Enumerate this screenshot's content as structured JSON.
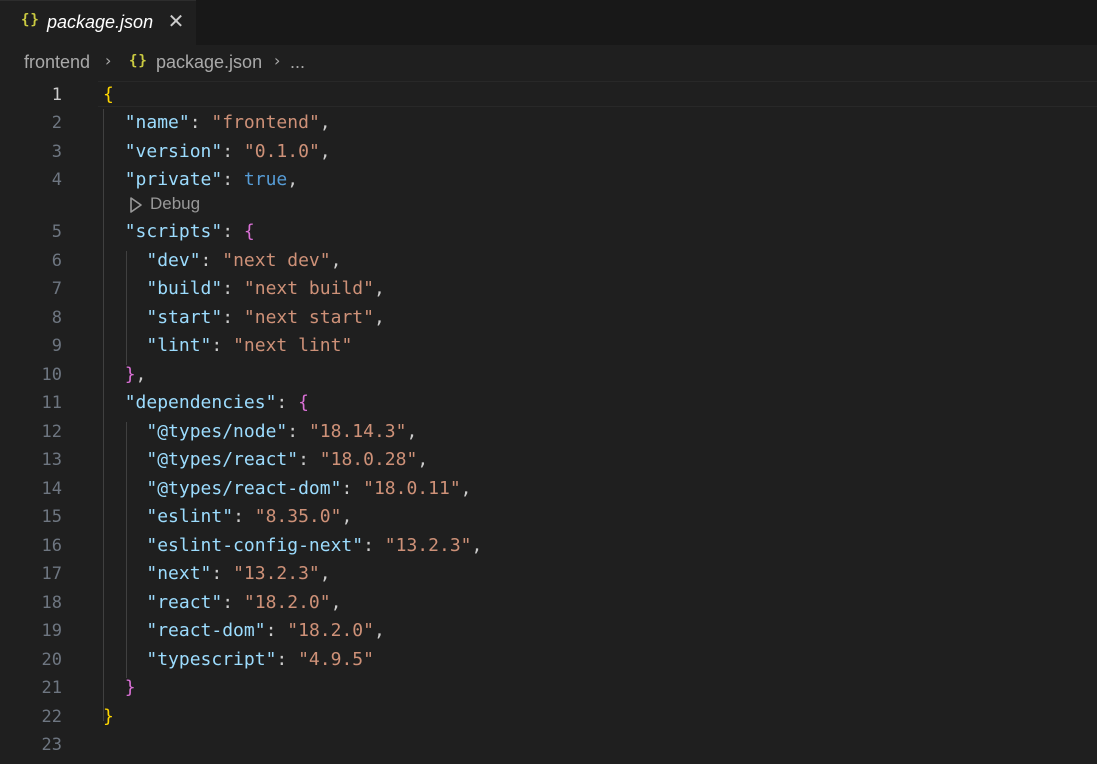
{
  "tab": {
    "icon": "{}",
    "title": "package.json",
    "close": "✕"
  },
  "breadcrumb": {
    "folder": "frontend",
    "file_icon": "{}",
    "file": "package.json",
    "more": "..."
  },
  "codelens": {
    "label": "Debug"
  },
  "colors": {
    "key": "#9cdcfe",
    "string": "#ce9178",
    "boolean": "#569cd6",
    "bracket_level1": "#ffd700",
    "bracket_level2": "#da70d6",
    "json_icon": "#cbcb41"
  },
  "lines": [
    {
      "n": "1"
    },
    {
      "n": "2"
    },
    {
      "n": "3"
    },
    {
      "n": "4"
    },
    {
      "n": "5"
    },
    {
      "n": "6"
    },
    {
      "n": "7"
    },
    {
      "n": "8"
    },
    {
      "n": "9"
    },
    {
      "n": "10"
    },
    {
      "n": "11"
    },
    {
      "n": "12"
    },
    {
      "n": "13"
    },
    {
      "n": "14"
    },
    {
      "n": "15"
    },
    {
      "n": "16"
    },
    {
      "n": "17"
    },
    {
      "n": "18"
    },
    {
      "n": "19"
    },
    {
      "n": "20"
    },
    {
      "n": "21"
    },
    {
      "n": "22"
    },
    {
      "n": "23"
    }
  ],
  "json": {
    "open_brace": "{",
    "close_brace": "}",
    "name": {
      "key": "\"name\"",
      "value": "\"frontend\""
    },
    "version": {
      "key": "\"version\"",
      "value": "\"0.1.0\""
    },
    "private": {
      "key": "\"private\"",
      "value": "true"
    },
    "scripts": {
      "key": "\"scripts\"",
      "dev": {
        "key": "\"dev\"",
        "value": "\"next dev\""
      },
      "build": {
        "key": "\"build\"",
        "value": "\"next build\""
      },
      "start": {
        "key": "\"start\"",
        "value": "\"next start\""
      },
      "lint": {
        "key": "\"lint\"",
        "value": "\"next lint\""
      }
    },
    "dependencies": {
      "key": "\"dependencies\"",
      "items": [
        {
          "key": "\"@types/node\"",
          "value": "\"18.14.3\""
        },
        {
          "key": "\"@types/react\"",
          "value": "\"18.0.28\""
        },
        {
          "key": "\"@types/react-dom\"",
          "value": "\"18.0.11\""
        },
        {
          "key": "\"eslint\"",
          "value": "\"8.35.0\""
        },
        {
          "key": "\"eslint-config-next\"",
          "value": "\"13.2.3\""
        },
        {
          "key": "\"next\"",
          "value": "\"13.2.3\""
        },
        {
          "key": "\"react\"",
          "value": "\"18.2.0\""
        },
        {
          "key": "\"react-dom\"",
          "value": "\"18.2.0\""
        },
        {
          "key": "\"typescript\"",
          "value": "\"4.9.5\""
        }
      ]
    }
  }
}
